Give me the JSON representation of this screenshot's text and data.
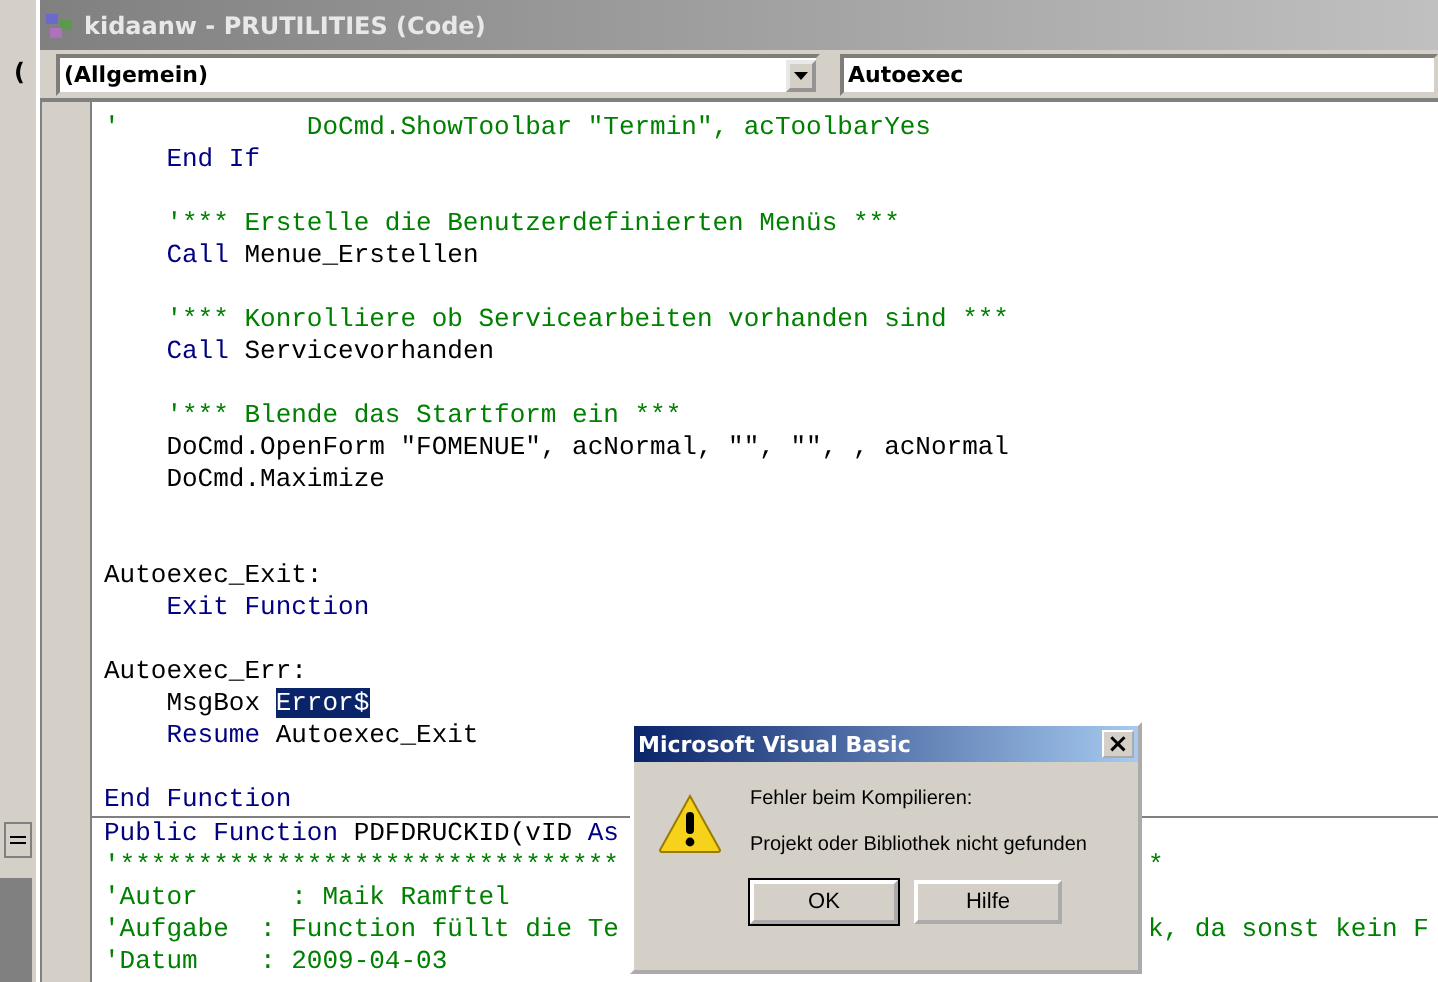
{
  "background_window": {
    "fragment": "("
  },
  "window": {
    "title": "kidaanw - PRUTILITIES (Code)"
  },
  "object_combo": {
    "value": "(Allgemein)"
  },
  "procedure_combo": {
    "value": "Autoexec"
  },
  "procedures": [
    {
      "lines": [
        {
          "segments": [
            {
              "kind": "comment",
              "text": "'            DoCmd.ShowToolbar \"Termin\", acToolbarYes"
            }
          ]
        },
        {
          "segments": [
            {
              "kind": "keyword",
              "text": "    End If"
            }
          ]
        },
        {
          "kind": "blank"
        },
        {
          "segments": [
            {
              "kind": "comment",
              "text": "    '*** Erstelle die Benutzerdefinierten Menüs ***"
            }
          ]
        },
        {
          "segments": [
            {
              "kind": "keyword",
              "text": "    Call"
            },
            {
              "kind": "plain",
              "text": " Menue_Erstellen"
            }
          ]
        },
        {
          "kind": "blank"
        },
        {
          "segments": [
            {
              "kind": "comment",
              "text": "    '*** Konrolliere ob Servicearbeiten vorhanden sind ***"
            }
          ]
        },
        {
          "segments": [
            {
              "kind": "keyword",
              "text": "    Call"
            },
            {
              "kind": "plain",
              "text": " Servicevorhanden"
            }
          ]
        },
        {
          "kind": "blank"
        },
        {
          "segments": [
            {
              "kind": "comment",
              "text": "    '*** Blende das Startform ein ***"
            }
          ]
        },
        {
          "segments": [
            {
              "kind": "plain",
              "text": "    DoCmd.OpenForm \"FOMENUE\", acNormal, \"\", \"\", , acNormal"
            }
          ]
        },
        {
          "segments": [
            {
              "kind": "plain",
              "text": "    DoCmd.Maximize"
            }
          ]
        },
        {
          "kind": "blank"
        },
        {
          "kind": "blank"
        },
        {
          "segments": [
            {
              "kind": "plain",
              "text": "Autoexec_Exit:"
            }
          ]
        },
        {
          "segments": [
            {
              "kind": "keyword",
              "text": "    Exit Function"
            }
          ]
        },
        {
          "kind": "blank"
        },
        {
          "segments": [
            {
              "kind": "plain",
              "text": "Autoexec_Err:"
            }
          ]
        },
        {
          "segments": [
            {
              "kind": "plain",
              "text": "    MsgBox "
            },
            {
              "kind": "selection",
              "text": "Error$"
            }
          ]
        },
        {
          "segments": [
            {
              "kind": "keyword",
              "text": "    Resume"
            },
            {
              "kind": "plain",
              "text": " Autoexec_Exit"
            }
          ]
        },
        {
          "kind": "blank"
        },
        {
          "segments": [
            {
              "kind": "keyword",
              "text": "End Function"
            }
          ]
        }
      ]
    },
    {
      "lines": [
        {
          "segments": [
            {
              "kind": "keyword",
              "text": "Public Function"
            },
            {
              "kind": "plain",
              "text": " PDFDRUCKID(vID "
            },
            {
              "kind": "keyword",
              "text": "As"
            }
          ]
        },
        {
          "segments": [
            {
              "kind": "comment",
              "text": "'********************************"
            }
          ],
          "tail": [
            {
              "kind": "comment",
              "text": "*"
            }
          ]
        },
        {
          "segments": [
            {
              "kind": "comment",
              "text": "'Autor      : Maik Ramftel"
            }
          ]
        },
        {
          "segments": [
            {
              "kind": "comment",
              "text": "'Aufgabe  : Function füllt die Te"
            }
          ],
          "tail": [
            {
              "kind": "comment",
              "text": "k, da sonst kein F"
            }
          ]
        },
        {
          "segments": [
            {
              "kind": "comment",
              "text": "'Datum    : 2009-04-03"
            }
          ]
        }
      ]
    }
  ],
  "dialog": {
    "title": "Microsoft Visual Basic",
    "close": "×",
    "heading": "Fehler beim Kompilieren:",
    "message": "Projekt oder Bibliothek nicht gefunden",
    "buttons": [
      {
        "label": "OK",
        "selected": true
      },
      {
        "label": "Hilfe",
        "selected": false
      }
    ]
  }
}
